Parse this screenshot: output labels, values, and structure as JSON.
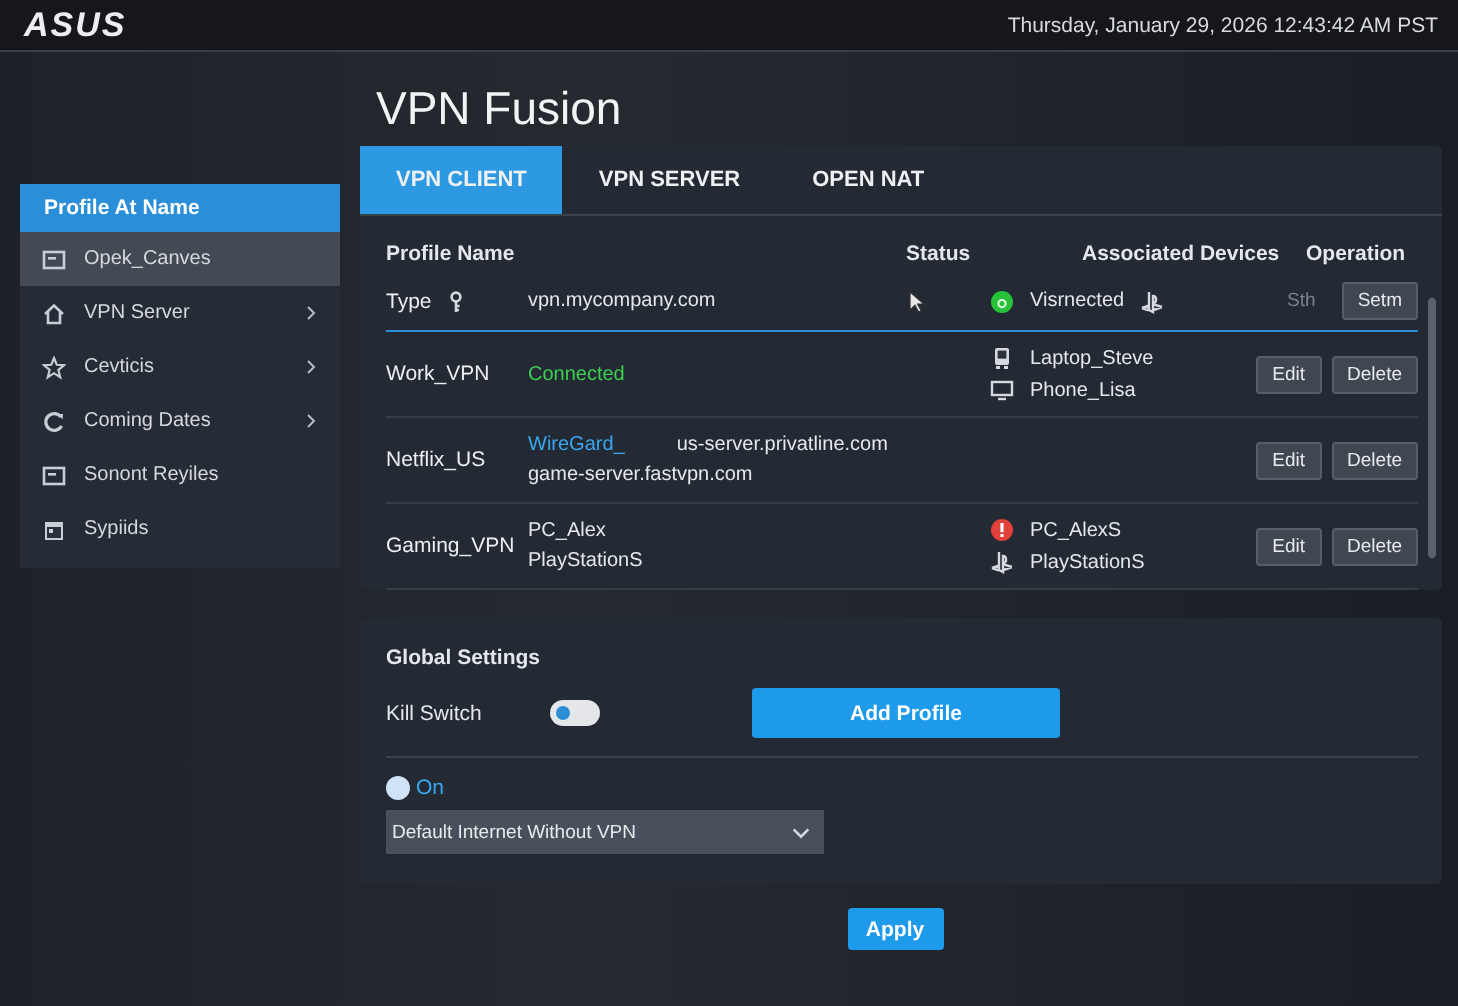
{
  "header": {
    "logo": "ASUS",
    "datetime": "Thursday, January 29, 2026 12:43:42 AM PST"
  },
  "page_title": "VPN Fusion",
  "sidebar": {
    "title": "Profile At Name",
    "items": [
      {
        "label": "Opek_Canves",
        "kind": "card",
        "selected": true,
        "expandable": false
      },
      {
        "label": "VPN Server",
        "kind": "home",
        "selected": false,
        "expandable": true
      },
      {
        "label": "Cevticis",
        "kind": "star",
        "selected": false,
        "expandable": true
      },
      {
        "label": "Coming Dates",
        "kind": "refresh",
        "selected": false,
        "expandable": true
      },
      {
        "label": "Sonont Reyiles",
        "kind": "card",
        "selected": false,
        "expandable": false
      },
      {
        "label": "Sypiids",
        "kind": "calendar",
        "selected": false,
        "expandable": false
      }
    ]
  },
  "tabs": [
    {
      "label": "VPN CLIENT",
      "selected": true
    },
    {
      "label": "VPN SERVER",
      "selected": false
    },
    {
      "label": "OPEN NAT",
      "selected": false
    }
  ],
  "table": {
    "columns": [
      "Profile Name",
      "Status",
      "Associated Devices",
      "Operation"
    ],
    "rows": [
      {
        "name": "Type",
        "kind": "draft",
        "selected": true,
        "details": [
          [
            {
              "text": "vpn.mycompany.com",
              "kind": "plain"
            }
          ]
        ],
        "devices": [
          {
            "kind": "ok",
            "name": "Visrnected"
          }
        ],
        "operations": [
          {
            "label": "Sth",
            "kind": "faded"
          },
          {
            "label": "Setm",
            "kind": "button"
          }
        ]
      },
      {
        "name": "Work_VPN",
        "kind": "profile",
        "selected": false,
        "details": [
          [
            {
              "text": "Connected",
              "kind": "green"
            }
          ]
        ],
        "devices": [
          {
            "kind": "laptop",
            "name": "Laptop_Steve"
          },
          {
            "kind": "monitor",
            "name": "Phone_Lisa"
          }
        ],
        "operations": [
          {
            "label": "Edit",
            "kind": "button"
          },
          {
            "label": "Delete",
            "kind": "button"
          }
        ]
      },
      {
        "name": "Netflix_US",
        "kind": "profile",
        "selected": false,
        "details": [
          [
            {
              "text": "WireGard_",
              "kind": "blue"
            },
            {
              "text": "us-server.privatline.com",
              "kind": "plain"
            }
          ],
          [
            {
              "text": "game-server.fastvpn.com",
              "kind": "plain"
            }
          ]
        ],
        "operations": [
          {
            "label": "Edit",
            "kind": "button"
          },
          {
            "label": "Delete",
            "kind": "button"
          }
        ]
      },
      {
        "name": "Gaming_VPN",
        "kind": "profile",
        "selected": false,
        "details": [
          [
            {
              "text": "PC_Alex",
              "kind": "plain"
            }
          ],
          [
            {
              "text": "PlayStationS",
              "kind": "plain"
            }
          ]
        ],
        "devices": [
          {
            "kind": "alert",
            "name": "PC_AlexS"
          },
          {
            "kind": "gamepad",
            "name": "PlayStationS"
          }
        ],
        "operations": [
          {
            "label": "Edit",
            "kind": "button"
          },
          {
            "label": "Delete",
            "kind": "button"
          }
        ]
      }
    ]
  },
  "global_settings": {
    "title": "Global Settings",
    "kill_switch": {
      "label": "Kill Switch",
      "on": false
    },
    "add_button": "Add Profile",
    "mode_toggle": {
      "label": "On",
      "on": true
    },
    "dropdown": {
      "value": "Default Internet Without VPN"
    }
  },
  "apply_button": "Apply"
}
